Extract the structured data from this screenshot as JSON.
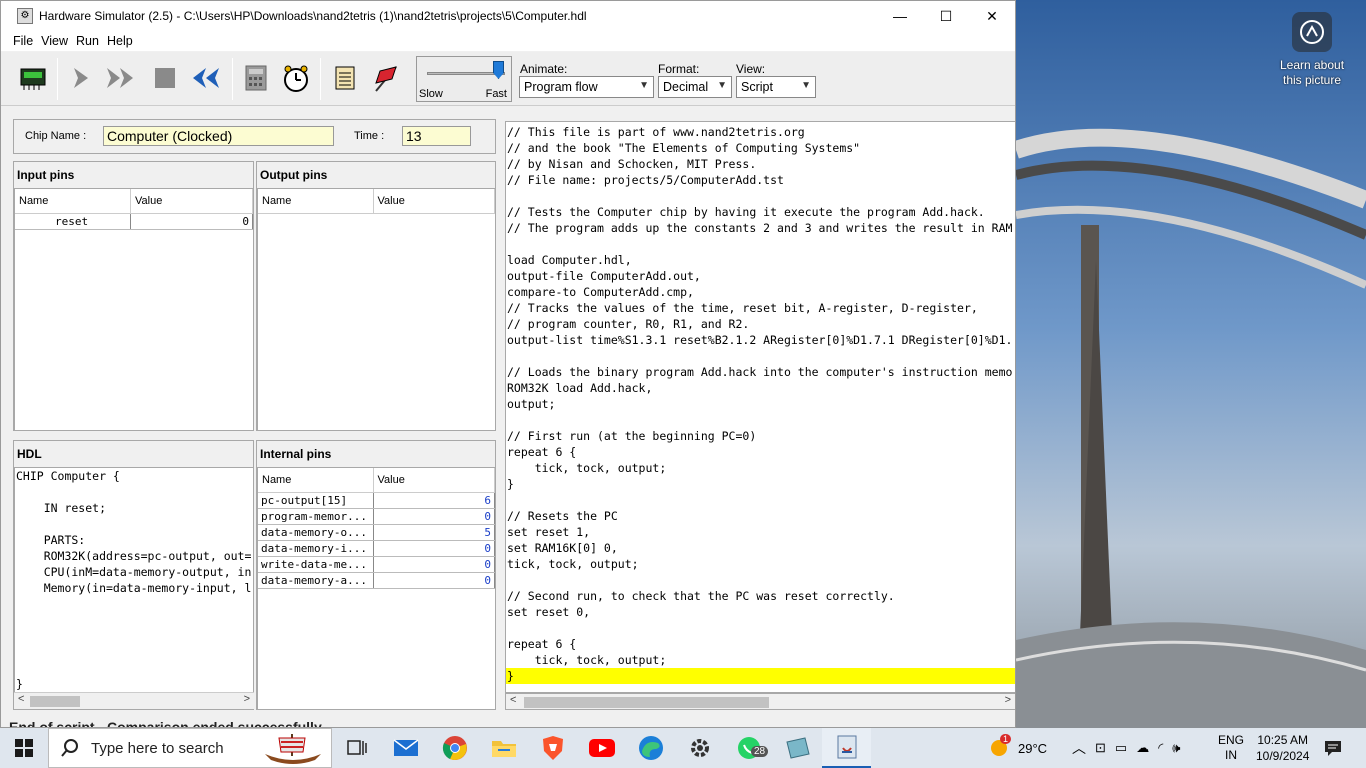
{
  "window": {
    "title": "Hardware Simulator (2.5) - C:\\Users\\HP\\Downloads\\nand2tetris (1)\\nand2tetris\\projects\\5\\Computer.hdl",
    "controls": [
      "—",
      "☐",
      "✕"
    ]
  },
  "menu": [
    "File",
    "View",
    "Run",
    "Help"
  ],
  "toolbar": {
    "speed": {
      "slow": "Slow",
      "fast": "Fast",
      "level": 0.9
    },
    "animate": {
      "label": "Animate:",
      "value": "Program flow"
    },
    "format": {
      "label": "Format:",
      "value": "Decimal"
    },
    "view": {
      "label": "View:",
      "value": "Script"
    }
  },
  "chip": {
    "name_label": "Chip Name :",
    "name": "Computer (Clocked)",
    "time_label": "Time :",
    "time": "13"
  },
  "input_pins": {
    "title": "Input pins",
    "headers": [
      "Name",
      "Value"
    ],
    "rows": [
      {
        "name": "reset",
        "value": "0"
      }
    ]
  },
  "output_pins": {
    "title": "Output pins",
    "headers": [
      "Name",
      "Value"
    ]
  },
  "hdl": {
    "title": "HDL",
    "lines": [
      "CHIP Computer {",
      "",
      "    IN reset;",
      "",
      "    PARTS:",
      "    ROM32K(address=pc-output, out=",
      "    CPU(inM=data-memory-output, in",
      "    Memory(in=data-memory-input, l",
      "",
      "",
      "",
      "",
      "",
      "}"
    ]
  },
  "internal_pins": {
    "title": "Internal pins",
    "headers": [
      "Name",
      "Value"
    ],
    "rows": [
      {
        "name": "  pc-output[15]",
        "value": "6"
      },
      {
        "name": "program-memor...",
        "value": "0"
      },
      {
        "name": "data-memory-o...",
        "value": "5"
      },
      {
        "name": "data-memory-i...",
        "value": "0"
      },
      {
        "name": "write-data-me...",
        "value": "0"
      },
      {
        "name": "data-memory-a...",
        "value": "0"
      }
    ]
  },
  "script": {
    "lines": [
      "// This file is part of www.nand2tetris.org",
      "// and the book \"The Elements of Computing Systems\"",
      "// by Nisan and Schocken, MIT Press.",
      "// File name: projects/5/ComputerAdd.tst",
      "",
      "// Tests the Computer chip by having it execute the program Add.hack.",
      "// The program adds up the constants 2 and 3 and writes the result in RAM",
      "",
      "load Computer.hdl,",
      "output-file ComputerAdd.out,",
      "compare-to ComputerAdd.cmp,",
      "// Tracks the values of the time, reset bit, A-register, D-register,",
      "// program counter, R0, R1, and R2.",
      "output-list time%S1.3.1 reset%B2.1.2 ARegister[0]%D1.7.1 DRegister[0]%D1.",
      "",
      "// Loads the binary program Add.hack into the computer's instruction memo",
      "ROM32K load Add.hack,",
      "output;",
      "",
      "// First run (at the beginning PC=0)",
      "repeat 6 {",
      "    tick, tock, output;",
      "}",
      "",
      "// Resets the PC",
      "set reset 1,",
      "set RAM16K[0] 0,",
      "tick, tock, output;",
      "",
      "// Second run, to check that the PC was reset correctly.",
      "set reset 0,",
      "",
      "repeat 6 {",
      "    tick, tock, output;",
      "}"
    ],
    "highlight_index": 34
  },
  "status": "End of script - Comparison ended successfully",
  "desktop": {
    "learn": "Learn about this picture"
  },
  "taskbar": {
    "search_placeholder": "Type here to search",
    "whatsapp_badge": "28",
    "weather": "29°C",
    "weather_badge": "1",
    "lang1": "ENG",
    "lang2": "IN",
    "time": "10:25 AM",
    "date": "10/9/2024"
  }
}
